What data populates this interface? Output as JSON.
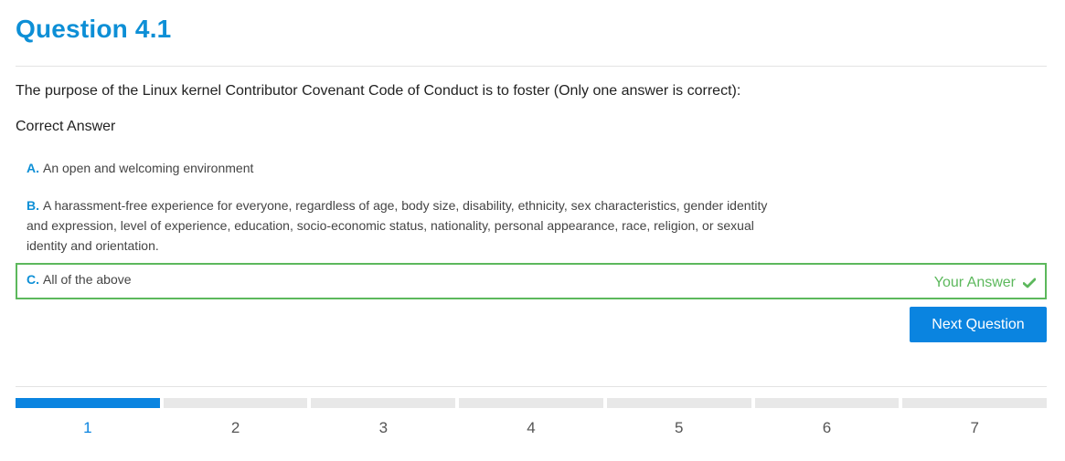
{
  "title": "Question 4.1",
  "question": "The purpose of the Linux kernel Contributor Covenant Code of Conduct is to foster (Only one answer is correct):",
  "correct_answer_label": "Correct Answer",
  "options": [
    {
      "letter": "A.",
      "text": "An open and welcoming environment"
    },
    {
      "letter": "B.",
      "text": "A harassment-free experience for everyone, regardless of age, body size, disability, ethnicity, sex characteristics, gender identity and expression, level of experience, education, socio-economic status, nationality, personal appearance, race, religion, or sexual identity and orientation."
    },
    {
      "letter": "C.",
      "text": "All of the above"
    }
  ],
  "selected_option": "C",
  "your_answer_label": "Your Answer",
  "next_button_label": "Next Question",
  "progress": {
    "current": 1,
    "steps": [
      "1",
      "2",
      "3",
      "4",
      "5",
      "6",
      "7"
    ]
  },
  "colors": {
    "accent": "#0a84e0",
    "title": "#0d8fd6",
    "correct": "#5cb85c"
  },
  "icons": {
    "your_answer": "check-icon"
  }
}
